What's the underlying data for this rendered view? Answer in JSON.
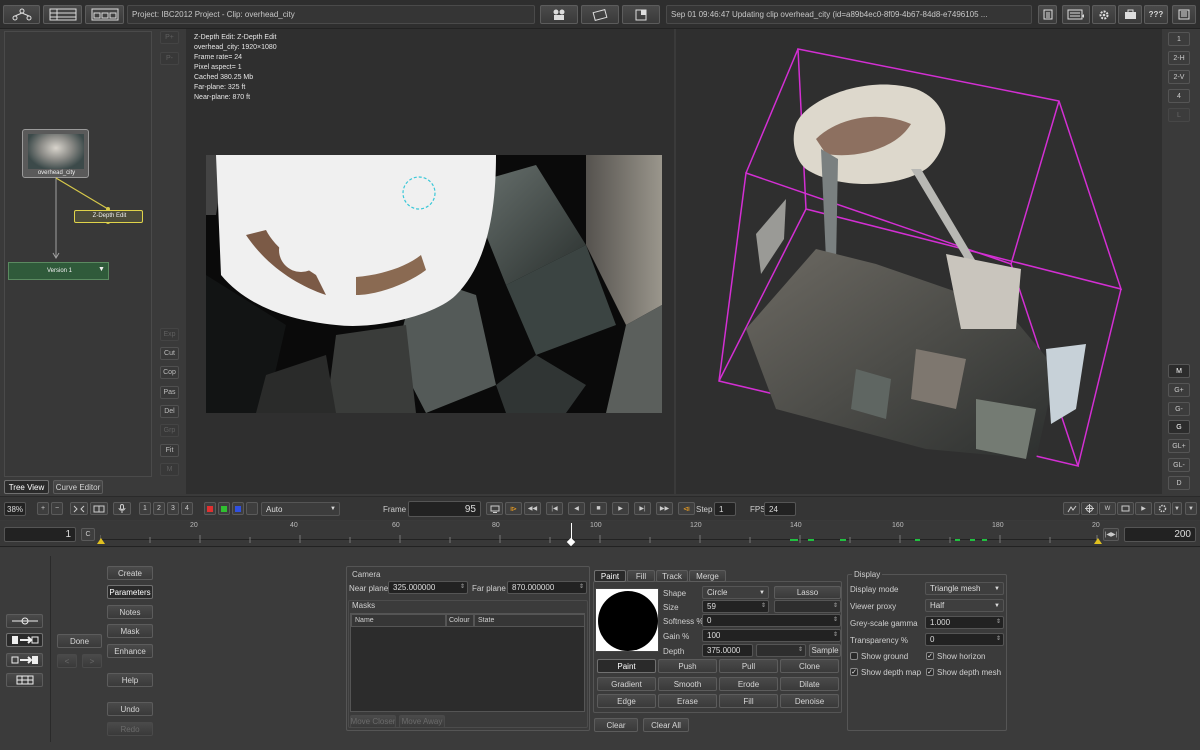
{
  "topbar": {
    "project_clip": "Project: IBC2012 Project - Clip: overhead_city",
    "status": "Sep 01 09:46:47 Updating clip overhead_city (id=a89b4ec0-8f09-4b67-84d8-e7496105 ...",
    "help_label": "???"
  },
  "tree": {
    "node_clip_label": "overhead_city",
    "node_edit_label": "Z-Depth Edit",
    "node_version_label": "Version 1",
    "side_buttons": [
      "P+",
      "P-",
      "Exp",
      "Cut",
      "Cop",
      "Pas",
      "Del",
      "Grp",
      "Fit",
      "M"
    ],
    "tabs": [
      "Tree View",
      "Curve Editor"
    ]
  },
  "viewer_info": [
    "Z-Depth Edit: Z-Depth Edit",
    "overhead_city: 1920×1080",
    "Frame rate= 24",
    "Pixel aspect= 1",
    "Cached 380.25 Mb",
    "Far-plane: 325 ft",
    "Near-plane: 870 ft"
  ],
  "right_view_buttons": [
    "1",
    "2-H",
    "2-V",
    "4",
    "L",
    "M",
    "G+",
    "G-",
    "G",
    "GL+",
    "GL-",
    "D"
  ],
  "transport": {
    "zoom": "38%",
    "view_nums": [
      "1",
      "2",
      "3",
      "4"
    ],
    "channel_mode": "Auto",
    "frame_label": "Frame",
    "frame_value": "95",
    "step_label": "Step",
    "step_value": "1",
    "fps_label": "FPS",
    "fps_value": "24"
  },
  "timeline": {
    "start": "1",
    "end": "200",
    "c_label": "C",
    "ticks": [
      "20",
      "40",
      "60",
      "80",
      "100",
      "120",
      "140",
      "160",
      "180",
      "20"
    ]
  },
  "left_actions": {
    "stack": [
      "Create",
      "Parameters",
      "Notes",
      "Mask",
      "Enhance",
      "Help",
      "Undo",
      "Redo"
    ],
    "done": "Done"
  },
  "camera": {
    "title": "Camera",
    "near_label": "Near plane",
    "near_value": "325.000000",
    "far_label": "Far plane",
    "far_value": "870.000000"
  },
  "masks": {
    "title": "Masks",
    "columns": [
      "Name",
      "Colour",
      "State"
    ],
    "move_closer": "Move Closer",
    "move_away": "Move Away"
  },
  "paint": {
    "tabs": [
      "Paint",
      "Fill",
      "Track",
      "Merge"
    ],
    "shape_label": "Shape",
    "shape_value": "Circle",
    "lasso": "Lasso",
    "size_label": "Size",
    "size_value": "59",
    "softness_label": "Softness %",
    "softness_value": "0",
    "gain_label": "Gain %",
    "gain_value": "100",
    "depth_label": "Depth",
    "depth_value": "375.0000",
    "sample": "Sample",
    "tools": [
      "Paint",
      "Push",
      "Pull",
      "Clone",
      "Gradient",
      "Smooth",
      "Erode",
      "Dilate",
      "Edge",
      "Erase",
      "Fill",
      "Denoise"
    ],
    "clear": "Clear",
    "clear_all": "Clear All"
  },
  "display": {
    "title": "Display",
    "mode_label": "Display mode",
    "mode_value": "Triangle mesh",
    "proxy_label": "Viewer proxy",
    "proxy_value": "Half",
    "gamma_label": "Grey-scale gamma",
    "gamma_value": "1.000",
    "transparency_label": "Transparency %",
    "transparency_value": "0",
    "show_ground": "Show ground",
    "show_horizon": "Show horizon",
    "show_depth_map": "Show depth map",
    "show_depth_mesh": "Show depth mesh"
  }
}
